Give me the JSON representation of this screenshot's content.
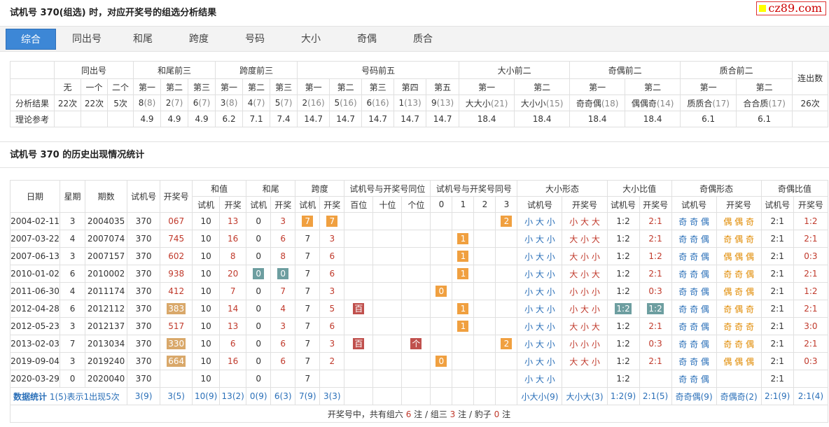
{
  "title1": "试机号 370(组选) 时，对应开奖号的组选分析结果",
  "title2": "试机号 370 的历史出现情况统计",
  "logo": "cz89.com",
  "tabs": [
    "综合",
    "同出号",
    "和尾",
    "跨度",
    "号码",
    "大小",
    "奇偶",
    "质合"
  ],
  "summary": {
    "groups": [
      "同出号",
      "和尾前三",
      "跨度前三",
      "号码前五",
      "大小前二",
      "奇偶前二",
      "质合前二",
      "连出数"
    ],
    "sub": [
      "无",
      "一个",
      "二个",
      "第一",
      "第二",
      "第三",
      "第一",
      "第二",
      "第三",
      "第一",
      "第二",
      "第三",
      "第四",
      "第五",
      "第一",
      "第二",
      "第一",
      "第二",
      "第一",
      "第二"
    ],
    "row_label": "分析结果",
    "row": [
      [
        "22次",
        ""
      ],
      [
        "22次",
        ""
      ],
      [
        "5次",
        ""
      ],
      [
        "8",
        "(8)"
      ],
      [
        "2",
        "(7)"
      ],
      [
        "6",
        "(7)"
      ],
      [
        "3",
        "(8)"
      ],
      [
        "4",
        "(7)"
      ],
      [
        "5",
        "(7)"
      ],
      [
        "2",
        "(16)"
      ],
      [
        "5",
        "(16)"
      ],
      [
        "6",
        "(16)"
      ],
      [
        "1",
        "(13)"
      ],
      [
        "9",
        "(13)"
      ],
      [
        "大大小",
        "(21)"
      ],
      [
        "大小小",
        "(15)"
      ],
      [
        "奇奇偶",
        "(18)"
      ],
      [
        "偶偶奇",
        "(14)"
      ],
      [
        "质质合",
        "(17)"
      ],
      [
        "合合质",
        "(17)"
      ],
      [
        "26次",
        ""
      ]
    ],
    "ref_label": "理论参考",
    "ref": [
      "",
      "",
      "",
      "4.9",
      "4.9",
      "4.9",
      "6.2",
      "7.1",
      "7.4",
      "14.7",
      "14.7",
      "14.7",
      "14.7",
      "14.7",
      "18.4",
      "18.4",
      "18.4",
      "18.4",
      "6.1",
      "6.1",
      ""
    ]
  },
  "history": {
    "head1": [
      "日期",
      "星期",
      "期数",
      "试机号",
      "开奖号",
      "和值",
      "和尾",
      "跨度",
      "试机号与开奖号同位",
      "试机号与开奖号同号",
      "大小形态",
      "大小比值",
      "奇偶形态",
      "奇偶比值"
    ],
    "head2": [
      "试机",
      "开奖",
      "试机",
      "开奖",
      "试机",
      "开奖",
      "百位",
      "十位",
      "个位",
      "0",
      "1",
      "2",
      "3",
      "试机号",
      "开奖号",
      "试机号",
      "开奖号",
      "试机号",
      "开奖号",
      "试机号",
      "开奖号"
    ],
    "rows": [
      [
        "2004-02-11",
        "3",
        "2004035",
        "370",
        "067",
        "10",
        "13",
        "0",
        "3",
        "7",
        "7",
        "",
        "",
        "",
        "",
        "",
        "",
        "2",
        "",
        "小 大 小",
        "小 大 大",
        "1:2",
        "2:1",
        "奇 奇 偶",
        "偶 偶 奇",
        "2:1",
        "1:2"
      ],
      [
        "2007-03-22",
        "4",
        "2007074",
        "370",
        "745",
        "10",
        "16",
        "0",
        "6",
        "7",
        "3",
        "",
        "",
        "",
        "",
        "1",
        "",
        "",
        "",
        "小 大 小",
        "大 小 大",
        "1:2",
        "2:1",
        "奇 奇 偶",
        "奇 偶 奇",
        "2:1",
        "2:1"
      ],
      [
        "2007-06-13",
        "3",
        "2007157",
        "370",
        "602",
        "10",
        "8",
        "0",
        "8",
        "7",
        "6",
        "",
        "",
        "",
        "",
        "1",
        "",
        "",
        "",
        "小 大 小",
        "大 小 小",
        "1:2",
        "1:2",
        "奇 奇 偶",
        "偶 偶 偶",
        "2:1",
        "0:3"
      ],
      [
        "2010-01-02",
        "6",
        "2010002",
        "370",
        "938",
        "10",
        "20",
        "0",
        "0",
        "7",
        "6",
        "",
        "",
        "",
        "",
        "1",
        "",
        "",
        "",
        "小 大 小",
        "大 小 大",
        "1:2",
        "2:1",
        "奇 奇 偶",
        "奇 奇 偶",
        "2:1",
        "2:1"
      ],
      [
        "2011-06-30",
        "4",
        "2011174",
        "370",
        "412",
        "10",
        "7",
        "0",
        "7",
        "7",
        "3",
        "",
        "",
        "",
        "0",
        "",
        "",
        "",
        "",
        "小 大 小",
        "小 小 小",
        "1:2",
        "0:3",
        "奇 奇 偶",
        "偶 奇 偶",
        "2:1",
        "1:2"
      ],
      [
        "2012-04-28",
        "6",
        "2012112",
        "370",
        "383",
        "10",
        "14",
        "0",
        "4",
        "7",
        "5",
        "百",
        "",
        "",
        "",
        "1",
        "",
        "",
        "",
        "小 大 小",
        "小 大 小",
        "1:2",
        "1:2",
        "奇 奇 偶",
        "奇 偶 奇",
        "2:1",
        "2:1"
      ],
      [
        "2012-05-23",
        "3",
        "2012137",
        "370",
        "517",
        "10",
        "13",
        "0",
        "3",
        "7",
        "6",
        "",
        "",
        "",
        "",
        "1",
        "",
        "",
        "",
        "小 大 小",
        "大 小 大",
        "1:2",
        "2:1",
        "奇 奇 偶",
        "奇 奇 奇",
        "2:1",
        "3:0"
      ],
      [
        "2013-02-03",
        "7",
        "2013034",
        "370",
        "330",
        "10",
        "6",
        "0",
        "6",
        "7",
        "3",
        "百",
        "",
        "个",
        "",
        "",
        "",
        "2",
        "",
        "小 大 小",
        "小 小 小",
        "1:2",
        "0:3",
        "奇 奇 偶",
        "奇 奇 偶",
        "2:1",
        "2:1"
      ],
      [
        "2019-09-04",
        "3",
        "2019240",
        "370",
        "664",
        "10",
        "16",
        "0",
        "6",
        "7",
        "2",
        "",
        "",
        "",
        "0",
        "",
        "",
        "",
        "",
        "小 大 小",
        "大 大 小",
        "1:2",
        "2:1",
        "奇 奇 偶",
        "偶 偶 偶",
        "2:1",
        "0:3"
      ],
      [
        "2020-03-29",
        "0",
        "2020040",
        "370",
        "",
        "10",
        "",
        "0",
        "",
        "7",
        "",
        "",
        "",
        "",
        "",
        "",
        "",
        "",
        "",
        "小 大 小",
        "",
        "1:2",
        "",
        "奇 奇 偶",
        "",
        "2:1",
        ""
      ]
    ],
    "stat_label": "数据统计",
    "stat_note": "1(5)表示1出现5次",
    "stat": [
      "3(9)",
      "3(5)",
      "10(9)",
      "13(2)",
      "0(9)",
      "6(3)",
      "7(9)",
      "3(3)",
      "",
      "",
      "",
      "",
      "",
      "",
      "",
      "",
      "小大小(9)",
      "大小大(3)",
      "1:2(9)",
      "2:1(5)",
      "奇奇偶(9)",
      "奇偶奇(2)",
      "2:1(9)",
      "2:1(4)"
    ],
    "footer": {
      "prefix": "开奖号中，共有组六 ",
      "z6": "6",
      "mid1": " 注 / 组三 ",
      "z3": "3",
      "mid2": " 注 / 豹子 ",
      "bz": "0",
      "suffix": " 注"
    }
  }
}
